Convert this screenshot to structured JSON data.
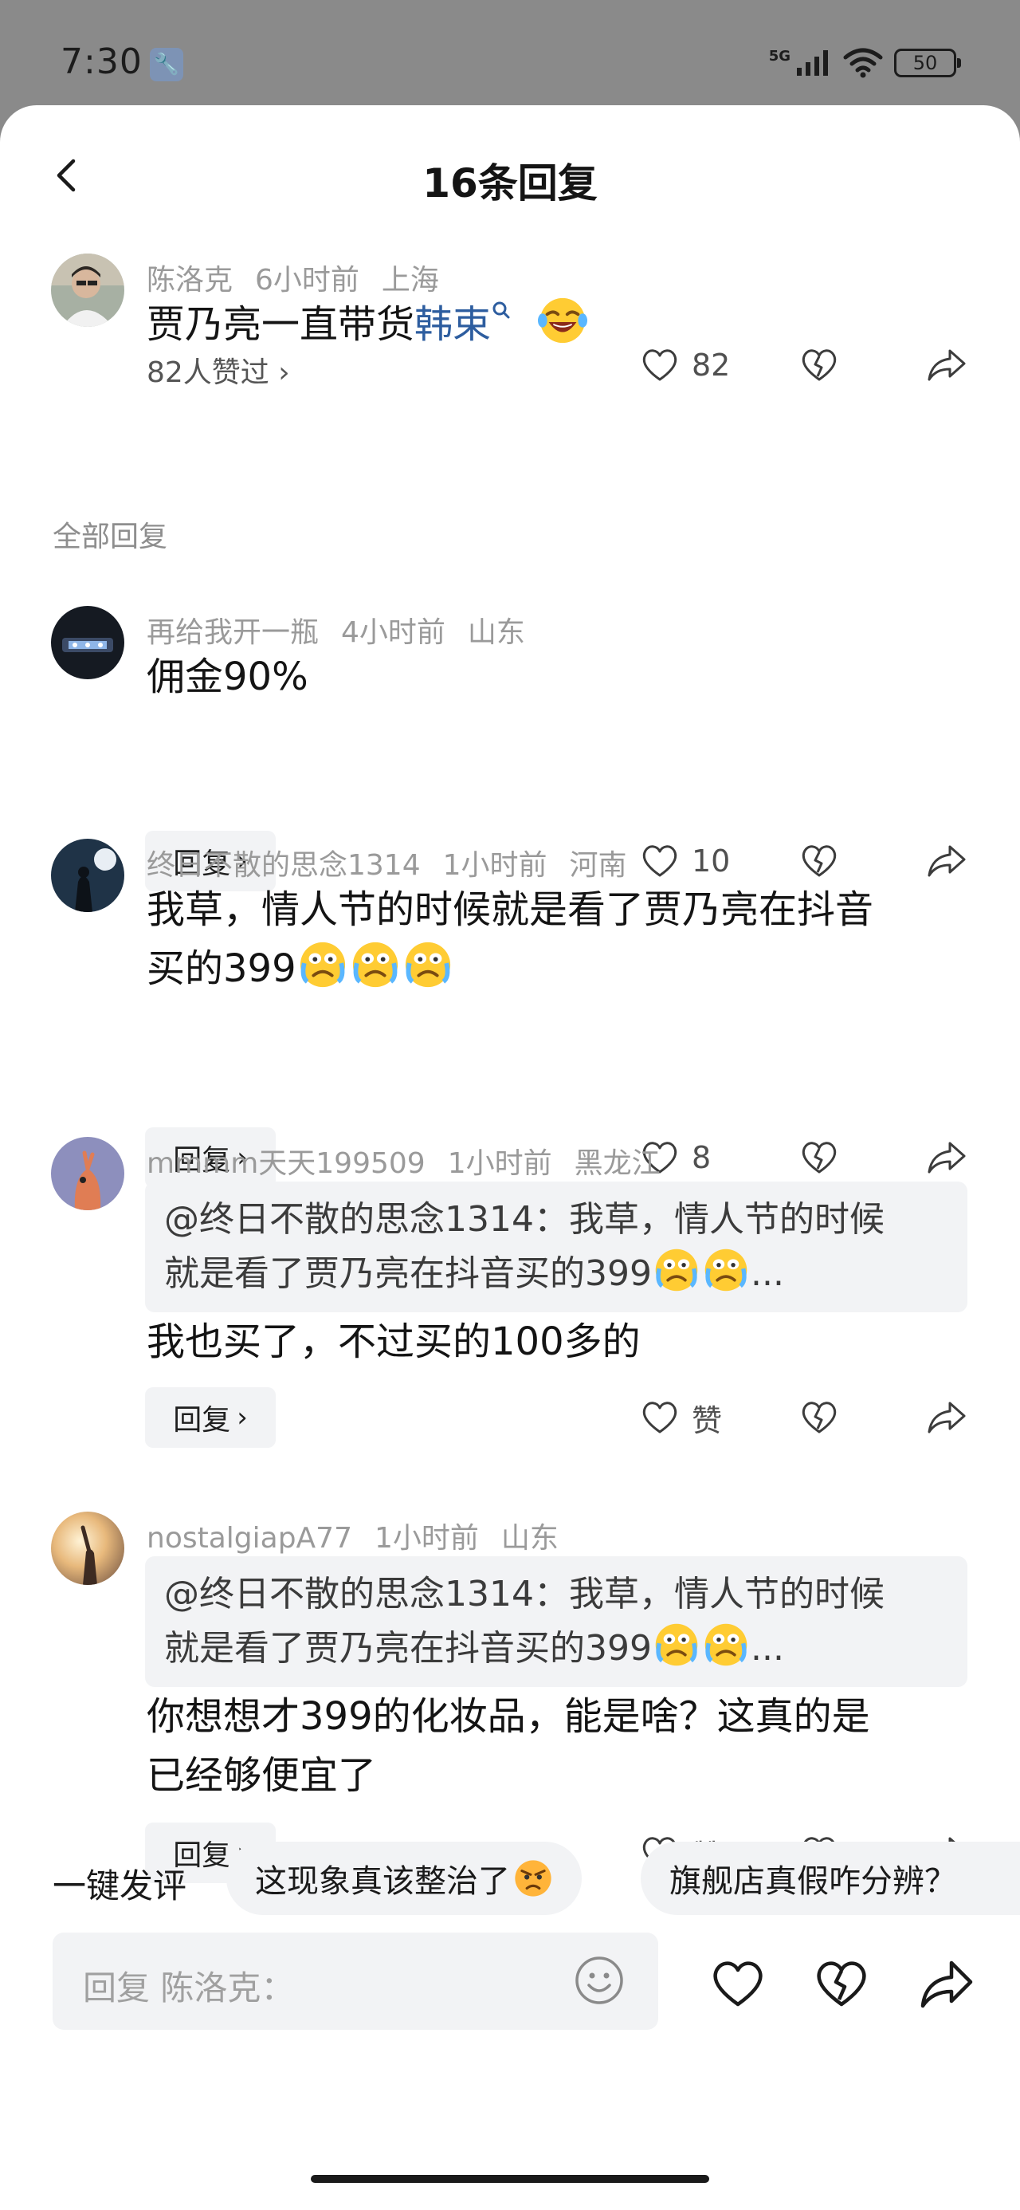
{
  "status_bar": {
    "time": "7:30",
    "network": "5G",
    "battery": "50"
  },
  "header": {
    "title": "16条回复",
    "back_icon": "chevron-left-icon"
  },
  "main_comment": {
    "user": "陈洛克",
    "time": "6小时前",
    "location": "上海",
    "text_prefix": "贾乃亮一直带货",
    "text_link": "韩束",
    "liked_by": "82人赞过",
    "likes": "82"
  },
  "section_label": "全部回复",
  "replies": [
    {
      "user": "再给我开一瓶",
      "time": "4小时前",
      "location": "山东",
      "text": "佣金90%",
      "reply_label": "回复",
      "likes": "10"
    },
    {
      "user": "终日不散的思念1314",
      "time": "1小时前",
      "location": "河南",
      "text_line1": "我草，情人节的时候就是看了贾乃亮在抖音",
      "text_line2": "买的399",
      "reply_label": "回复",
      "likes": "8"
    },
    {
      "user": "mmmm天天199509",
      "time": "1小时前",
      "location": "黑龙江",
      "quote_line1": "@终日不散的思念1314：我草，情人节的时候",
      "quote_line2": "就是看了贾乃亮在抖音买的399",
      "quote_ellipsis": "...",
      "text": "我也买了，不过买的100多的",
      "reply_label": "回复",
      "likes": "赞"
    },
    {
      "user": "nostalgiapA77",
      "time": "1小时前",
      "location": "山东",
      "quote_line1": "@终日不散的思念1314：我草，情人节的时候",
      "quote_line2": "就是看了贾乃亮在抖音买的399",
      "quote_ellipsis": "...",
      "text_line1": "你想想才399的化妆品，能是啥？这真的是",
      "text_line2": "已经够便宜了",
      "reply_label": "回复",
      "likes": "赞"
    }
  ],
  "quick_replies": {
    "label": "一键发评",
    "chips": [
      "这现象真该整治了",
      "旗舰店真假咋分辨？"
    ]
  },
  "input": {
    "placeholder": "回复 陈洛克："
  },
  "colors": {
    "link": "#2d5d9f",
    "background": "#ffffff",
    "chip": "#f2f3f5"
  }
}
